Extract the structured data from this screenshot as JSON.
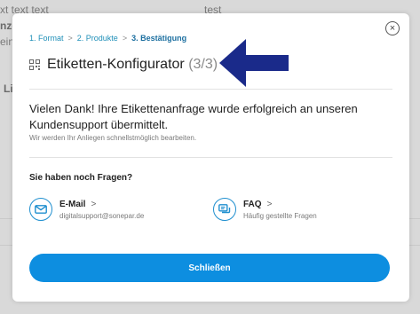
{
  "background": {
    "top_left_text": "xt text text",
    "top_center_text": "test",
    "left_clip_1": "nze",
    "left_clip_2": "ein",
    "left_clip_3": "Li"
  },
  "modal": {
    "stepper": {
      "step1": "1. Format",
      "step2": "2. Produkte",
      "step3": "3. Bestätigung",
      "separator": ">"
    },
    "title": "Etiketten-Konfigurator",
    "title_step": "(3/3)",
    "thanks_text": "Vielen Dank! Ihre Etikettenanfrage wurde erfolgreich an unseren Kundensupport übermittelt.",
    "sub_note": "Wir werden Ihr Anliegen schnellstmöglich bearbeiten.",
    "question": "Sie haben noch Fragen?",
    "contacts": {
      "email": {
        "title": "E-Mail",
        "chevron": ">",
        "subtitle": "digitalsupport@sonepar.de",
        "icon": "mail-icon"
      },
      "faq": {
        "title": "FAQ",
        "chevron": ">",
        "subtitle": "Häufig gestellte Fragen",
        "icon": "chat-icon"
      }
    },
    "close_button_label": "Schließen",
    "close_icon_glyph": "×"
  },
  "colors": {
    "accent": "#0d8ee0",
    "step_active": "#1c6fa0",
    "annotation_arrow": "#1a2a8a"
  }
}
